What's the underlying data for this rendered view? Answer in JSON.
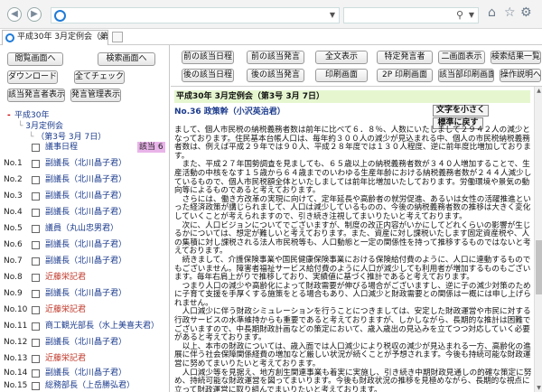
{
  "browser": {
    "address_value": "",
    "search_value": "",
    "tab_title": "平成30年 3月定例会（第3…"
  },
  "left": {
    "buttons": {
      "kaigiroku_list": "閲覧画面へ",
      "search_screen": "検索画面へ",
      "download": "ダウンロード",
      "check_all": "全てチェック",
      "show_speaker": "該当発言者表示",
      "speech_list": "発言管理表示"
    },
    "tree": {
      "year": "平成30年",
      "session": "3月定例会",
      "day": "（第3号 3月 7日）"
    },
    "rows": [
      {
        "no": "",
        "name": "議事日程",
        "red": false,
        "badge": "該当 6"
      },
      {
        "no": "No.1",
        "name": "副議長（北川晶子君）",
        "red": false
      },
      {
        "no": "No.2",
        "name": "副議長（北川晶子君）",
        "red": false
      },
      {
        "no": "No.3",
        "name": "副議長（北川晶子君）",
        "red": false
      },
      {
        "no": "No.4",
        "name": "副議長（北川晶子君）",
        "red": false
      },
      {
        "no": "No.5",
        "name": "議員（丸山忠男君）",
        "red": false
      },
      {
        "no": "No.6",
        "name": "副議長（北川晶子君）",
        "red": false
      },
      {
        "no": "No.7",
        "name": "副議長（北川晶子君）",
        "red": false
      },
      {
        "no": "No.8",
        "name": "近藤栄記君",
        "red": true
      },
      {
        "no": "No.9",
        "name": "副議長（北川晶子君）",
        "red": false
      },
      {
        "no": "No.10",
        "name": "近藤栄記君",
        "red": true
      },
      {
        "no": "No.11",
        "name": "商工観光部長（水上美喜夫君）",
        "red": false
      },
      {
        "no": "No.12",
        "name": "副議長（北川晶子君）",
        "red": false
      },
      {
        "no": "No.13",
        "name": "近藤栄記君",
        "red": true
      },
      {
        "no": "No.14",
        "name": "副議長（北川晶子君）",
        "red": false
      },
      {
        "no": "No.15",
        "name": "総務部長（上岳勝弘君）",
        "red": false
      },
      {
        "no": "No.16",
        "name": "副議長（北川晶子君）",
        "red": false
      }
    ]
  },
  "right": {
    "buttons": {
      "prev_speaker": "前の該当日程",
      "prev_speech": "前の該当発言",
      "show_all": "全文表示",
      "specific_speaker": "特定発言者",
      "two_column": "二画面表示",
      "result_list": "検索結果一覧へ",
      "next_speaker": "後の該当日程",
      "next_speech": "後の該当発言",
      "print_screen": "印刷画面",
      "print_2p": "2P 印刷画面",
      "print_hit": "該当部印刷画面",
      "ops": "操作説明へ"
    },
    "title": "平成30年 3月定例会（第3号 3月 7日）",
    "speaker": "No.36 政策幹（小沢英治君）",
    "text_smaller": "文字を小さく",
    "text_reset": "標準に戻す",
    "body": [
      "まして、個人市民税の納税義務者数は前年に比べて６．８％、人数にいたしまして２９４２人の減少となっております。住民基本台帳人口は、毎年約３００人の減少が見込まれる中、個人の市民税納税義務者数は、例えば平成２９年では９０人、平成２８年度では１３０人程度、逆に前年度比増加しております。",
      "　また、平成２７年国勢調査を見ましても、６５歳以上の納税義務者数が３４０人増加することで、生産活動の中核をなす１５歳から６４歳までのいわゆる生産年齢における納税義務者数が２４４人減少しているもので、個人市民税額全体といたしましては前年比増加いたしております。労働環境や景気の動向等によるものであると考えております。",
      "　さらには、働き方改革の実現に向けて、定年延長や高齢者の就労促進、あるいは女性の活躍推進といった経済政策が講じられまして、人口は減少しているものの、今後の納税義務者数の推移は大きく変化していくことが考えられますので、引き続き注視してまいりたいと考えております。",
      "　次に、人口ビジョンについてでございますが、制度の改正内容がいかにしてどれくらいの影響が生じるかについては、想定が難しいと考えております。また、資産に対し課税いたします固定資産税や、人の集積に対し課税される法人市民税等も、人口動態と一定の関係性を持って推移するものではないと考えております。",
      "　続きまして、介護保険事業や国民健康保険事業における保険給付費のように、人口に連動するものでもございません。障害者福祉サービス給付費のように人口が減少しても利用者が増加するものもございます。毎年右肩上がりで推移しており、実績値に基づく推計であると考えております。",
      "　つまり人口の減少や高齢化によって財政需要が伸びる場合がございますし、逆に子の減少対策のために子育て支援を手厚くする施策をとる場合もあり、人口減少と財政需要との関係は一概には申し上げられません。",
      "　人口減少に伴う財政シミュレーションを行うことにつきましては、安定した財政運営や市民に対する行政サービスの水準維持からも重要であると考えておりますが、しかしながら、長期的な推計は困難でございますので、中長期財政計画などの策定において、歳入歳出の見込みを立てつつ対応していく必要があると考えております。",
      "　以上、本市の財政については、歳入面では人口減少により税収の減少が見込まれる一方、高齢化の進展に伴う社会保障関係経費の増加など厳しい状況が続くことが予想されます。今後も持続可能な財政運営に努めてまいりたいと考えております。",
      "　人口減少等を見据え、地方創生関連事業も着実に実施し、引き続き中期財政見通しの的確な策定に努め、持続可能な財政運営を図ってまいります。今後も財政状況の推移を見極めながら、長期的な視点に立って財政運営に取り組んでまいりたいと考えております。"
    ]
  }
}
